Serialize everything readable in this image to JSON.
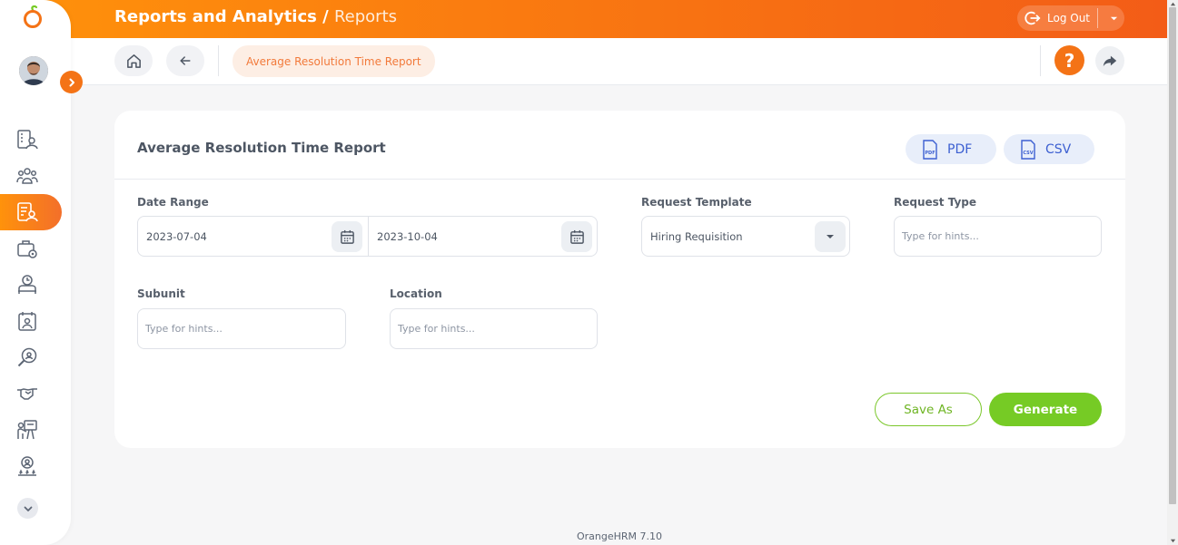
{
  "header": {
    "module": "Reports and Analytics /",
    "page": "Reports",
    "logout_label": "Log Out"
  },
  "subbar": {
    "breadcrumb": "Average Resolution Time Report",
    "help_label": "?"
  },
  "card": {
    "title": "Average Resolution Time Report",
    "pdf_label": "PDF",
    "csv_label": "CSV"
  },
  "form": {
    "date_range_label": "Date Range",
    "date_from": "2023-07-04",
    "date_to": "2023-10-04",
    "request_template_label": "Request Template",
    "request_template_value": "Hiring Requisition",
    "request_type_label": "Request Type",
    "request_type_placeholder": "Type for hints...",
    "subunit_label": "Subunit",
    "subunit_placeholder": "Type for hints...",
    "location_label": "Location",
    "location_placeholder": "Type for hints...",
    "save_as_label": "Save As",
    "generate_label": "Generate"
  },
  "footer": {
    "version": "OrangeHRM 7.10"
  },
  "colors": {
    "brand_orange": "#f47316",
    "accent_green": "#76cb25",
    "file_blue": "#3c5fd1"
  },
  "icons": {
    "sidebar": [
      "directory-icon",
      "people-icon",
      "reports-icon",
      "settings-briefcase-icon",
      "time-icon",
      "leave-calendar-icon",
      "recruitment-search-icon",
      "onboarding-handshake-icon",
      "training-icon",
      "performance-award-icon"
    ]
  }
}
